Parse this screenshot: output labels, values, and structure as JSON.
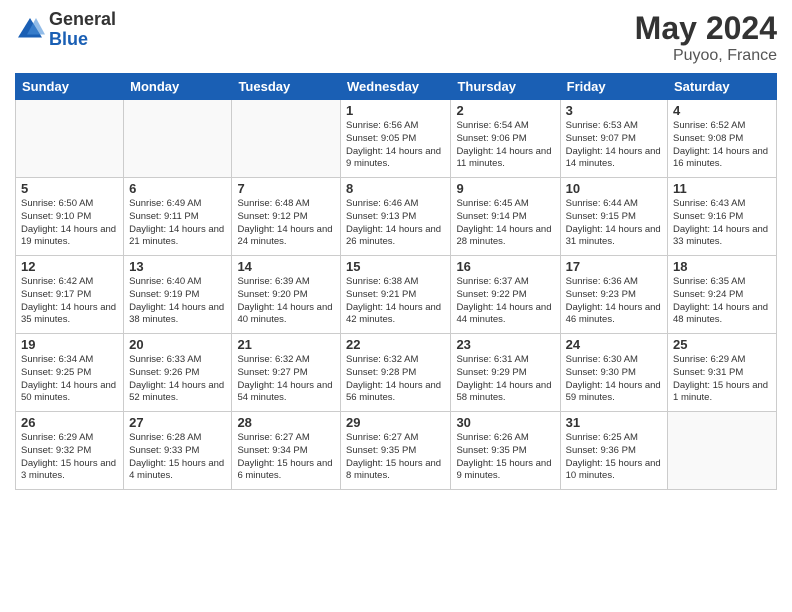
{
  "header": {
    "logo_general": "General",
    "logo_blue": "Blue",
    "title": "May 2024",
    "location": "Puyoo, France"
  },
  "weekdays": [
    "Sunday",
    "Monday",
    "Tuesday",
    "Wednesday",
    "Thursday",
    "Friday",
    "Saturday"
  ],
  "weeks": [
    [
      {
        "day": "",
        "info": ""
      },
      {
        "day": "",
        "info": ""
      },
      {
        "day": "",
        "info": ""
      },
      {
        "day": "1",
        "info": "Sunrise: 6:56 AM\nSunset: 9:05 PM\nDaylight: 14 hours\nand 9 minutes."
      },
      {
        "day": "2",
        "info": "Sunrise: 6:54 AM\nSunset: 9:06 PM\nDaylight: 14 hours\nand 11 minutes."
      },
      {
        "day": "3",
        "info": "Sunrise: 6:53 AM\nSunset: 9:07 PM\nDaylight: 14 hours\nand 14 minutes."
      },
      {
        "day": "4",
        "info": "Sunrise: 6:52 AM\nSunset: 9:08 PM\nDaylight: 14 hours\nand 16 minutes."
      }
    ],
    [
      {
        "day": "5",
        "info": "Sunrise: 6:50 AM\nSunset: 9:10 PM\nDaylight: 14 hours\nand 19 minutes."
      },
      {
        "day": "6",
        "info": "Sunrise: 6:49 AM\nSunset: 9:11 PM\nDaylight: 14 hours\nand 21 minutes."
      },
      {
        "day": "7",
        "info": "Sunrise: 6:48 AM\nSunset: 9:12 PM\nDaylight: 14 hours\nand 24 minutes."
      },
      {
        "day": "8",
        "info": "Sunrise: 6:46 AM\nSunset: 9:13 PM\nDaylight: 14 hours\nand 26 minutes."
      },
      {
        "day": "9",
        "info": "Sunrise: 6:45 AM\nSunset: 9:14 PM\nDaylight: 14 hours\nand 28 minutes."
      },
      {
        "day": "10",
        "info": "Sunrise: 6:44 AM\nSunset: 9:15 PM\nDaylight: 14 hours\nand 31 minutes."
      },
      {
        "day": "11",
        "info": "Sunrise: 6:43 AM\nSunset: 9:16 PM\nDaylight: 14 hours\nand 33 minutes."
      }
    ],
    [
      {
        "day": "12",
        "info": "Sunrise: 6:42 AM\nSunset: 9:17 PM\nDaylight: 14 hours\nand 35 minutes."
      },
      {
        "day": "13",
        "info": "Sunrise: 6:40 AM\nSunset: 9:19 PM\nDaylight: 14 hours\nand 38 minutes."
      },
      {
        "day": "14",
        "info": "Sunrise: 6:39 AM\nSunset: 9:20 PM\nDaylight: 14 hours\nand 40 minutes."
      },
      {
        "day": "15",
        "info": "Sunrise: 6:38 AM\nSunset: 9:21 PM\nDaylight: 14 hours\nand 42 minutes."
      },
      {
        "day": "16",
        "info": "Sunrise: 6:37 AM\nSunset: 9:22 PM\nDaylight: 14 hours\nand 44 minutes."
      },
      {
        "day": "17",
        "info": "Sunrise: 6:36 AM\nSunset: 9:23 PM\nDaylight: 14 hours\nand 46 minutes."
      },
      {
        "day": "18",
        "info": "Sunrise: 6:35 AM\nSunset: 9:24 PM\nDaylight: 14 hours\nand 48 minutes."
      }
    ],
    [
      {
        "day": "19",
        "info": "Sunrise: 6:34 AM\nSunset: 9:25 PM\nDaylight: 14 hours\nand 50 minutes."
      },
      {
        "day": "20",
        "info": "Sunrise: 6:33 AM\nSunset: 9:26 PM\nDaylight: 14 hours\nand 52 minutes."
      },
      {
        "day": "21",
        "info": "Sunrise: 6:32 AM\nSunset: 9:27 PM\nDaylight: 14 hours\nand 54 minutes."
      },
      {
        "day": "22",
        "info": "Sunrise: 6:32 AM\nSunset: 9:28 PM\nDaylight: 14 hours\nand 56 minutes."
      },
      {
        "day": "23",
        "info": "Sunrise: 6:31 AM\nSunset: 9:29 PM\nDaylight: 14 hours\nand 58 minutes."
      },
      {
        "day": "24",
        "info": "Sunrise: 6:30 AM\nSunset: 9:30 PM\nDaylight: 14 hours\nand 59 minutes."
      },
      {
        "day": "25",
        "info": "Sunrise: 6:29 AM\nSunset: 9:31 PM\nDaylight: 15 hours\nand 1 minute."
      }
    ],
    [
      {
        "day": "26",
        "info": "Sunrise: 6:29 AM\nSunset: 9:32 PM\nDaylight: 15 hours\nand 3 minutes."
      },
      {
        "day": "27",
        "info": "Sunrise: 6:28 AM\nSunset: 9:33 PM\nDaylight: 15 hours\nand 4 minutes."
      },
      {
        "day": "28",
        "info": "Sunrise: 6:27 AM\nSunset: 9:34 PM\nDaylight: 15 hours\nand 6 minutes."
      },
      {
        "day": "29",
        "info": "Sunrise: 6:27 AM\nSunset: 9:35 PM\nDaylight: 15 hours\nand 8 minutes."
      },
      {
        "day": "30",
        "info": "Sunrise: 6:26 AM\nSunset: 9:35 PM\nDaylight: 15 hours\nand 9 minutes."
      },
      {
        "day": "31",
        "info": "Sunrise: 6:25 AM\nSunset: 9:36 PM\nDaylight: 15 hours\nand 10 minutes."
      },
      {
        "day": "",
        "info": ""
      }
    ]
  ]
}
